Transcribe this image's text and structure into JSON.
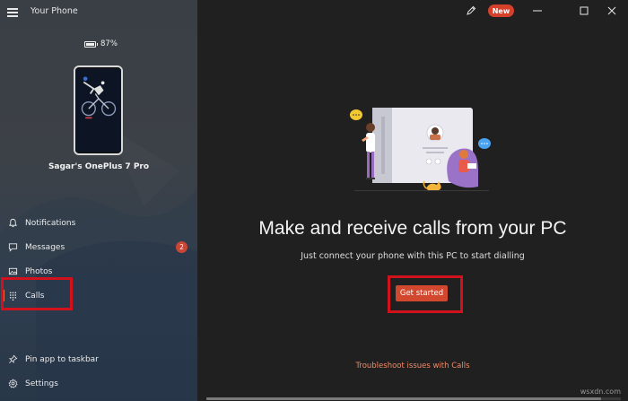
{
  "app": {
    "title": "Your Phone"
  },
  "device": {
    "battery": "87%",
    "name": "Sagar's OnePlus 7 Pro"
  },
  "sidebar": {
    "items": [
      {
        "label": "Notifications",
        "icon": "bell-icon"
      },
      {
        "label": "Messages",
        "icon": "message-icon",
        "badge": "2"
      },
      {
        "label": "Photos",
        "icon": "photo-icon"
      },
      {
        "label": "Calls",
        "icon": "dialpad-icon",
        "active": true
      }
    ],
    "bottom_items": [
      {
        "label": "Pin app to taskbar",
        "icon": "pin-icon"
      },
      {
        "label": "Settings",
        "icon": "gear-icon"
      }
    ]
  },
  "header": {
    "new_label": "New"
  },
  "main": {
    "headline": "Make and receive calls from your PC",
    "subtext": "Just connect your phone with this PC to start dialling",
    "cta_label": "Get started",
    "troubleshoot_link": "Troubleshoot issues with Calls"
  },
  "watermark": "wsxdn.com",
  "colors": {
    "accent": "#d2482f",
    "highlight": "#d1111b",
    "link": "#f08a68",
    "badge": "#c94637"
  }
}
